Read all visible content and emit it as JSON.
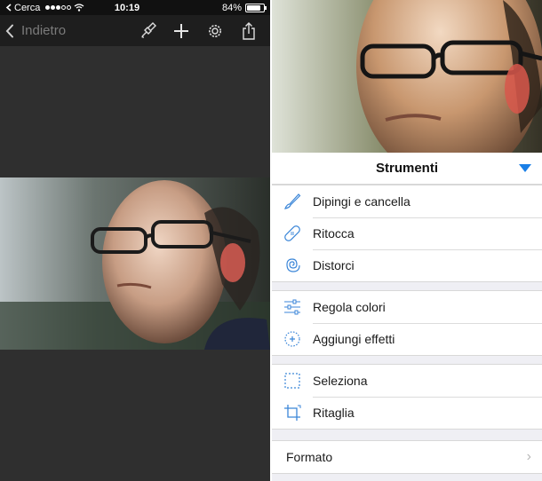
{
  "statusbar": {
    "carrier": "Cerca",
    "time": "10:19",
    "battery": "84%",
    "battery_level": 0.84
  },
  "navbar": {
    "back_label": "Indietro",
    "icons": [
      "brush-icon",
      "plus-icon",
      "settings-icon",
      "share-icon"
    ]
  },
  "colors": {
    "accent": "#1a7fe6",
    "dark_bg": "#2f2f2f",
    "navbar_bg": "#1e1e1e",
    "panel_bg": "#efeff4"
  },
  "tools_panel": {
    "title": "Strumenti",
    "groups": [
      [
        {
          "label": "Dipingi e cancella",
          "icon": "paintbrush-icon"
        },
        {
          "label": "Ritocca",
          "icon": "bandage-icon"
        },
        {
          "label": "Distorci",
          "icon": "spiral-icon"
        }
      ],
      [
        {
          "label": "Regola colori",
          "icon": "sliders-icon"
        },
        {
          "label": "Aggiungi effetti",
          "icon": "effects-icon"
        }
      ],
      [
        {
          "label": "Seleziona",
          "icon": "selection-icon"
        },
        {
          "label": "Ritaglia",
          "icon": "crop-icon"
        }
      ]
    ],
    "format_label": "Formato"
  }
}
